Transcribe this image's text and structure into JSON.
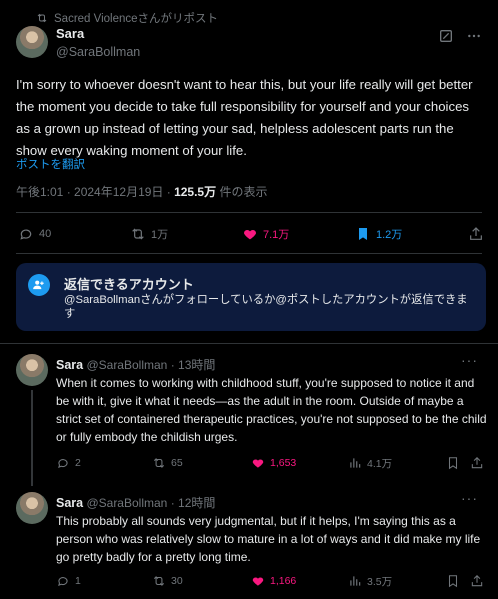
{
  "repost_label": "Sacred Violenceさんがリポスト",
  "post": {
    "name": "Sara",
    "handle": "@SaraBollman",
    "text": "I'm sorry to whoever doesn't want to hear this, but your life really will get better the moment you decide to take full responsibility for yourself and your choices as a grown up instead of letting your sad, helpless adolescent parts run the show every waking moment of your life.",
    "translate": "ポストを翻訳",
    "timestamp": "午後1:01 · 2024年12月19日 · ",
    "views_count": "125.5万",
    "views_suffix": " 件の表示",
    "stats": {
      "replies": "40",
      "reposts": "1万",
      "likes": "7.1万",
      "bookmarks": "1.2万"
    }
  },
  "reply_notice": {
    "title": "返信できるアカウント",
    "description": "@SaraBollmanさんがフォローしているか@ポストしたアカウントが返信できます"
  },
  "replies": [
    {
      "name": "Sara",
      "handle": "@SaraBollman",
      "time": "· 13時間",
      "text": "When it comes to working with childhood stuff, you're supposed to notice it and be with it, give it what it needs—as the adult in the room. Outside of maybe a strict set of containered therapeutic practices, you're not supposed to be the child or fully embody the childish urges.",
      "replies": "2",
      "reposts": "65",
      "likes": "1,653",
      "views": "4.1万"
    },
    {
      "name": "Sara",
      "handle": "@SaraBollman",
      "time": "· 12時間",
      "text": "This probably all sounds very judgmental, but if it helps, I'm saying this as a person who was relatively slow to mature in a lot of ways and it did make my life go pretty badly for a pretty long time.",
      "replies": "1",
      "reposts": "30",
      "likes": "1,166",
      "views": "3.5万"
    }
  ],
  "colors": {
    "accent": "#1d9bf0",
    "like": "#f91880",
    "muted": "#71767b",
    "notice_bg": "#0d1b3d"
  }
}
